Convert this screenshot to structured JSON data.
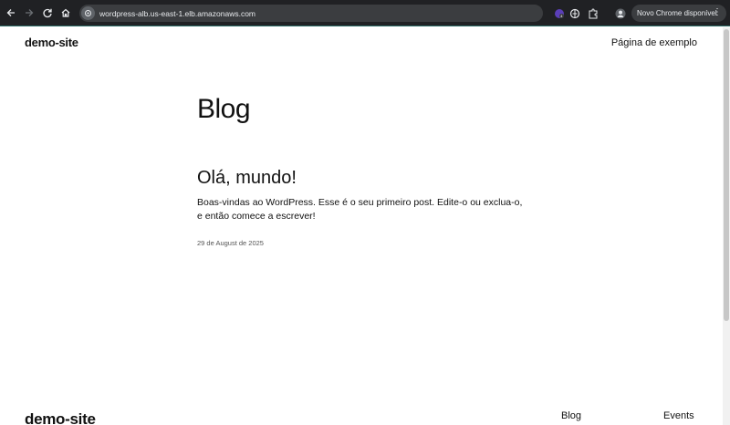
{
  "browser": {
    "url": "wordpress-alb.us-east-1.elb.amazonaws.com",
    "update_label": "Novo Chrome disponível"
  },
  "header": {
    "site_title": "demo-site",
    "nav_link": "Página de exemplo"
  },
  "main": {
    "heading": "Blog",
    "post": {
      "title": "Olá, mundo!",
      "excerpt": "Boas-vindas ao WordPress. Esse é o seu primeiro post. Edite-o ou exclua-o, e então comece a escrever!",
      "date": "29 de August de 2025"
    }
  },
  "footer": {
    "site_title": "demo-site",
    "links": [
      "Blog",
      "Events"
    ]
  },
  "colors": {
    "toolbar_bg": "#202124",
    "omnibox_bg": "#3b3d40",
    "page_bg": "#ffffff",
    "text": "#111111"
  }
}
